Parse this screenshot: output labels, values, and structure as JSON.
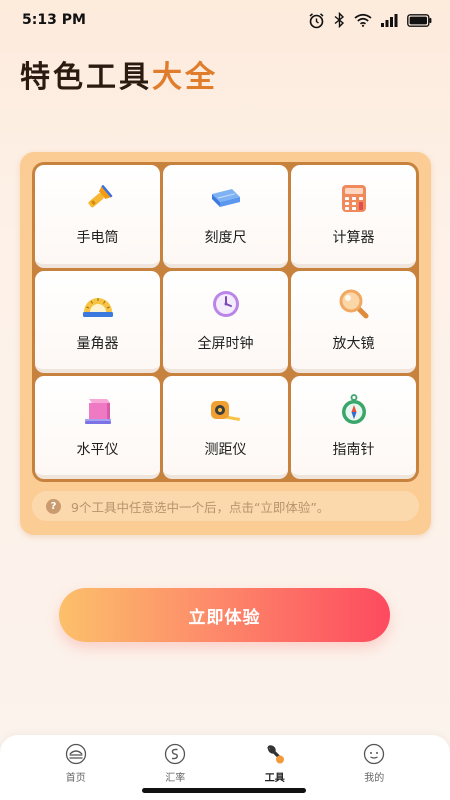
{
  "status_bar": {
    "time": "5:13 PM",
    "battery_level": "100"
  },
  "title": {
    "part1": "特色工具",
    "part2": "大全"
  },
  "tools": [
    {
      "label": "手电筒",
      "icon": "flashlight-icon"
    },
    {
      "label": "刻度尺",
      "icon": "ruler-icon"
    },
    {
      "label": "计算器",
      "icon": "calculator-icon"
    },
    {
      "label": "量角器",
      "icon": "protractor-icon"
    },
    {
      "label": "全屏时钟",
      "icon": "clock-icon"
    },
    {
      "label": "放大镜",
      "icon": "magnifier-icon"
    },
    {
      "label": "水平仪",
      "icon": "level-icon"
    },
    {
      "label": "测距仪",
      "icon": "tape-measure-icon"
    },
    {
      "label": "指南针",
      "icon": "compass-icon"
    }
  ],
  "hint": {
    "icon_text": "?",
    "text": "9个工具中任意选中一个后，点击“立即体验”。"
  },
  "cta": {
    "label": "立即体验"
  },
  "tab_bar": {
    "items": [
      {
        "label": "首页",
        "icon": "home-icon"
      },
      {
        "label": "汇率",
        "icon": "exchange-icon"
      },
      {
        "label": "工具",
        "icon": "tools-icon",
        "active": true
      },
      {
        "label": "我的",
        "icon": "profile-icon"
      }
    ]
  },
  "colors": {
    "accent": "#e07d2c",
    "panel": "#fbcd95",
    "grid_frame": "#c7823e",
    "cta_start": "#fcc06a",
    "cta_end": "#fd4a5f"
  }
}
